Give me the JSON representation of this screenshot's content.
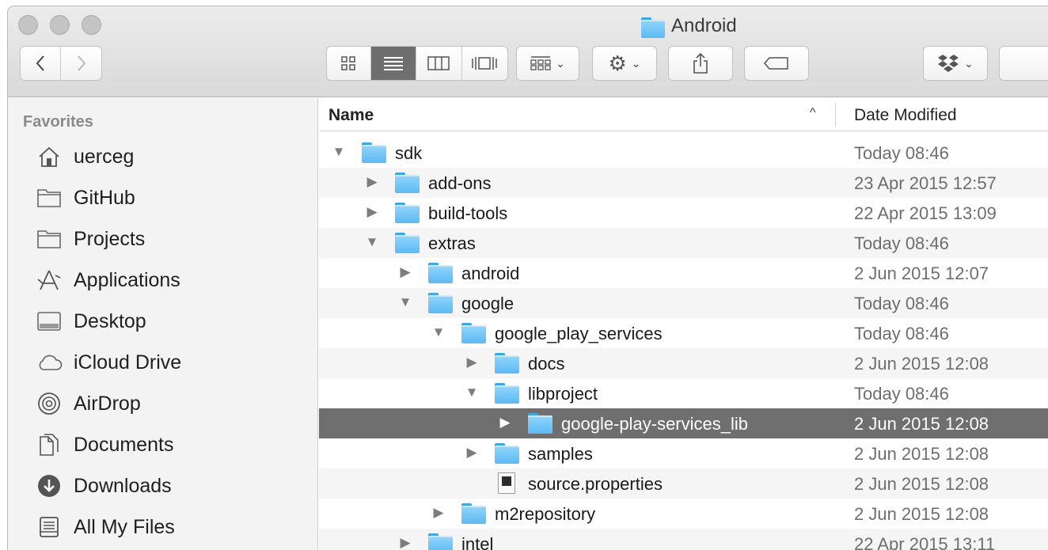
{
  "window": {
    "title": "Android"
  },
  "toolbar": {
    "back_icon": "chevron-left-icon",
    "forward_icon": "chevron-right-icon",
    "view_modes": [
      "icon-view",
      "list-view",
      "column-view",
      "cover-flow-view"
    ],
    "active_view": "list-view",
    "arrange_icon": "arrange-icon",
    "action_icon": "gear-icon",
    "share_icon": "share-icon",
    "tag_icon": "tag-icon",
    "dropbox_icon": "dropbox-icon"
  },
  "sidebar": {
    "heading": "Favorites",
    "items": [
      {
        "label": "uerceg",
        "icon": "home-icon"
      },
      {
        "label": "GitHub",
        "icon": "folder-icon"
      },
      {
        "label": "Projects",
        "icon": "folder-icon"
      },
      {
        "label": "Applications",
        "icon": "applications-icon"
      },
      {
        "label": "Desktop",
        "icon": "desktop-icon"
      },
      {
        "label": "iCloud Drive",
        "icon": "cloud-icon"
      },
      {
        "label": "AirDrop",
        "icon": "airdrop-icon"
      },
      {
        "label": "Documents",
        "icon": "documents-icon"
      },
      {
        "label": "Downloads",
        "icon": "downloads-icon"
      },
      {
        "label": "All My Files",
        "icon": "all-files-icon"
      }
    ]
  },
  "list": {
    "columns": {
      "name": "Name",
      "date": "Date Modified"
    },
    "sort_indicator": "^",
    "rows": [
      {
        "name": "sdk",
        "date": "Today 08:46",
        "depth": 0,
        "expander": "open",
        "type": "folder",
        "selected": false
      },
      {
        "name": "add-ons",
        "date": "23 Apr 2015 12:57",
        "depth": 1,
        "expander": "closed",
        "type": "folder",
        "selected": false
      },
      {
        "name": "build-tools",
        "date": "22 Apr 2015 13:09",
        "depth": 1,
        "expander": "closed",
        "type": "folder",
        "selected": false
      },
      {
        "name": "extras",
        "date": "Today 08:46",
        "depth": 1,
        "expander": "open",
        "type": "folder",
        "selected": false
      },
      {
        "name": "android",
        "date": "2 Jun 2015 12:07",
        "depth": 2,
        "expander": "closed",
        "type": "folder",
        "selected": false
      },
      {
        "name": "google",
        "date": "Today 08:46",
        "depth": 2,
        "expander": "open",
        "type": "folder",
        "selected": false
      },
      {
        "name": "google_play_services",
        "date": "Today 08:46",
        "depth": 3,
        "expander": "open",
        "type": "folder",
        "selected": false
      },
      {
        "name": "docs",
        "date": "2 Jun 2015 12:08",
        "depth": 4,
        "expander": "closed",
        "type": "folder",
        "selected": false
      },
      {
        "name": "libproject",
        "date": "Today 08:46",
        "depth": 4,
        "expander": "open",
        "type": "folder",
        "selected": false
      },
      {
        "name": "google-play-services_lib",
        "date": "2 Jun 2015 12:08",
        "depth": 5,
        "expander": "closed",
        "type": "folder",
        "selected": true
      },
      {
        "name": "samples",
        "date": "2 Jun 2015 12:08",
        "depth": 4,
        "expander": "closed",
        "type": "folder",
        "selected": false
      },
      {
        "name": "source.properties",
        "date": "2 Jun 2015 12:08",
        "depth": 4,
        "expander": "none",
        "type": "file",
        "selected": false
      },
      {
        "name": "m2repository",
        "date": "2 Jun 2015 12:08",
        "depth": 3,
        "expander": "closed",
        "type": "folder",
        "selected": false
      },
      {
        "name": "intel",
        "date": "22 Apr 2015 13:11",
        "depth": 2,
        "expander": "closed",
        "type": "folder",
        "selected": false
      }
    ]
  }
}
